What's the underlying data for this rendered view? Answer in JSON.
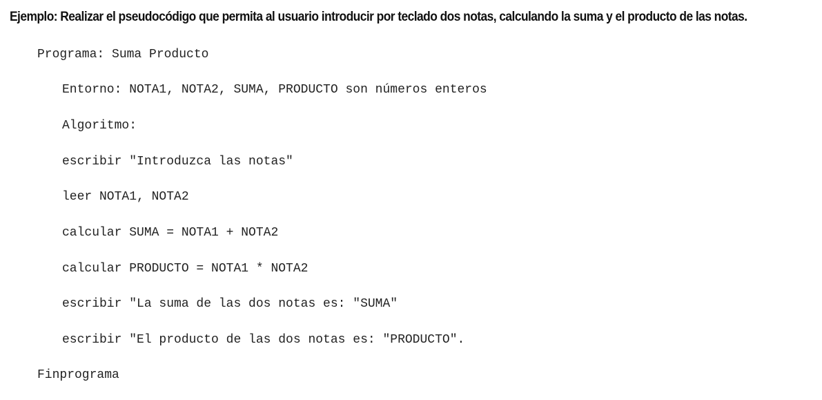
{
  "heading": "Ejemplo: Realizar el pseudocódigo que permita al usuario introducir por teclado dos notas, calculando la suma y el producto de las notas.",
  "code": {
    "lines": [
      "Programa: Suma Producto",
      "Entorno: NOTA1, NOTA2, SUMA, PRODUCTO son números enteros",
      "Algoritmo:",
      "escribir \"Introduzca las notas\"",
      "leer NOTA1, NOTA2",
      "calcular SUMA = NOTA1 + NOTA2",
      "calcular PRODUCTO = NOTA1 * NOTA2",
      "escribir \"La suma de las dos notas es: \"SUMA\"",
      "escribir \"El producto de las dos notas es: \"PRODUCTO\".",
      "Finprograma"
    ]
  }
}
